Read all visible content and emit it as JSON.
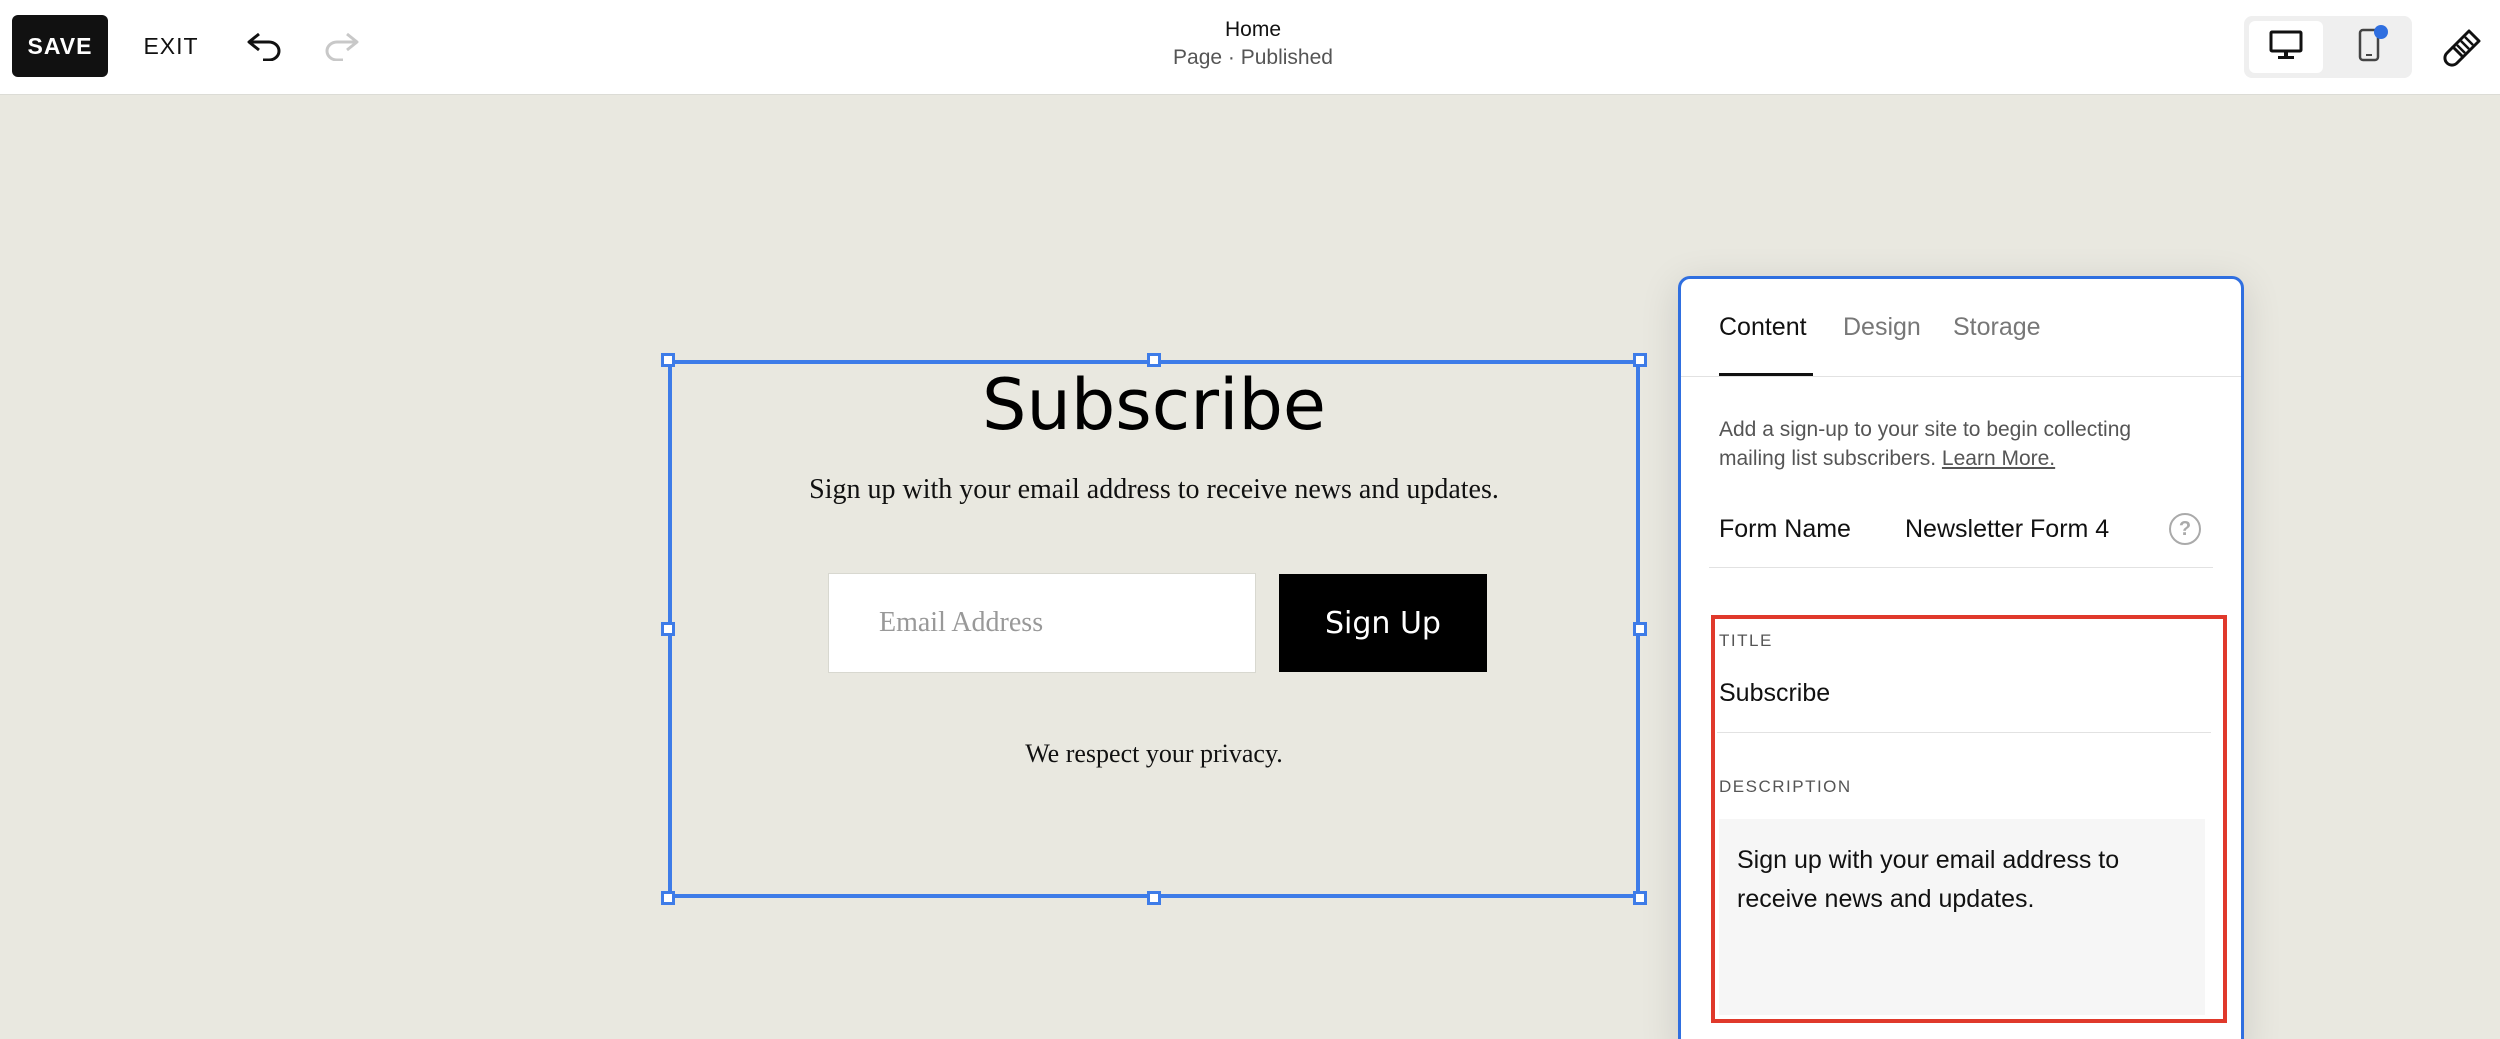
{
  "toolbar": {
    "save_label": "SAVE",
    "exit_label": "EXIT",
    "page_title": "Home",
    "page_status": "Page · Published"
  },
  "block": {
    "title": "Subscribe",
    "description": "Sign up with your email address to receive news and updates.",
    "email_placeholder": "Email Address",
    "button_label": "Sign Up",
    "footnote": "We respect your privacy."
  },
  "panel": {
    "tabs": [
      {
        "label": "Content",
        "active": true
      },
      {
        "label": "Design",
        "active": false
      },
      {
        "label": "Storage",
        "active": false
      }
    ],
    "help_text": "Add a sign-up to your site to begin collecting mailing list subscribers.",
    "learn_more": "Learn More.",
    "form_name_label": "Form Name",
    "form_name_value": "Newsletter Form 4",
    "title_label": "TITLE",
    "title_value": "Subscribe",
    "description_label": "DESCRIPTION",
    "description_value": "Sign up with your email address to receive news and updates."
  },
  "colors": {
    "accent": "#2f6fe0",
    "highlight": "#e0392b",
    "canvas": "#e9e8e0"
  }
}
